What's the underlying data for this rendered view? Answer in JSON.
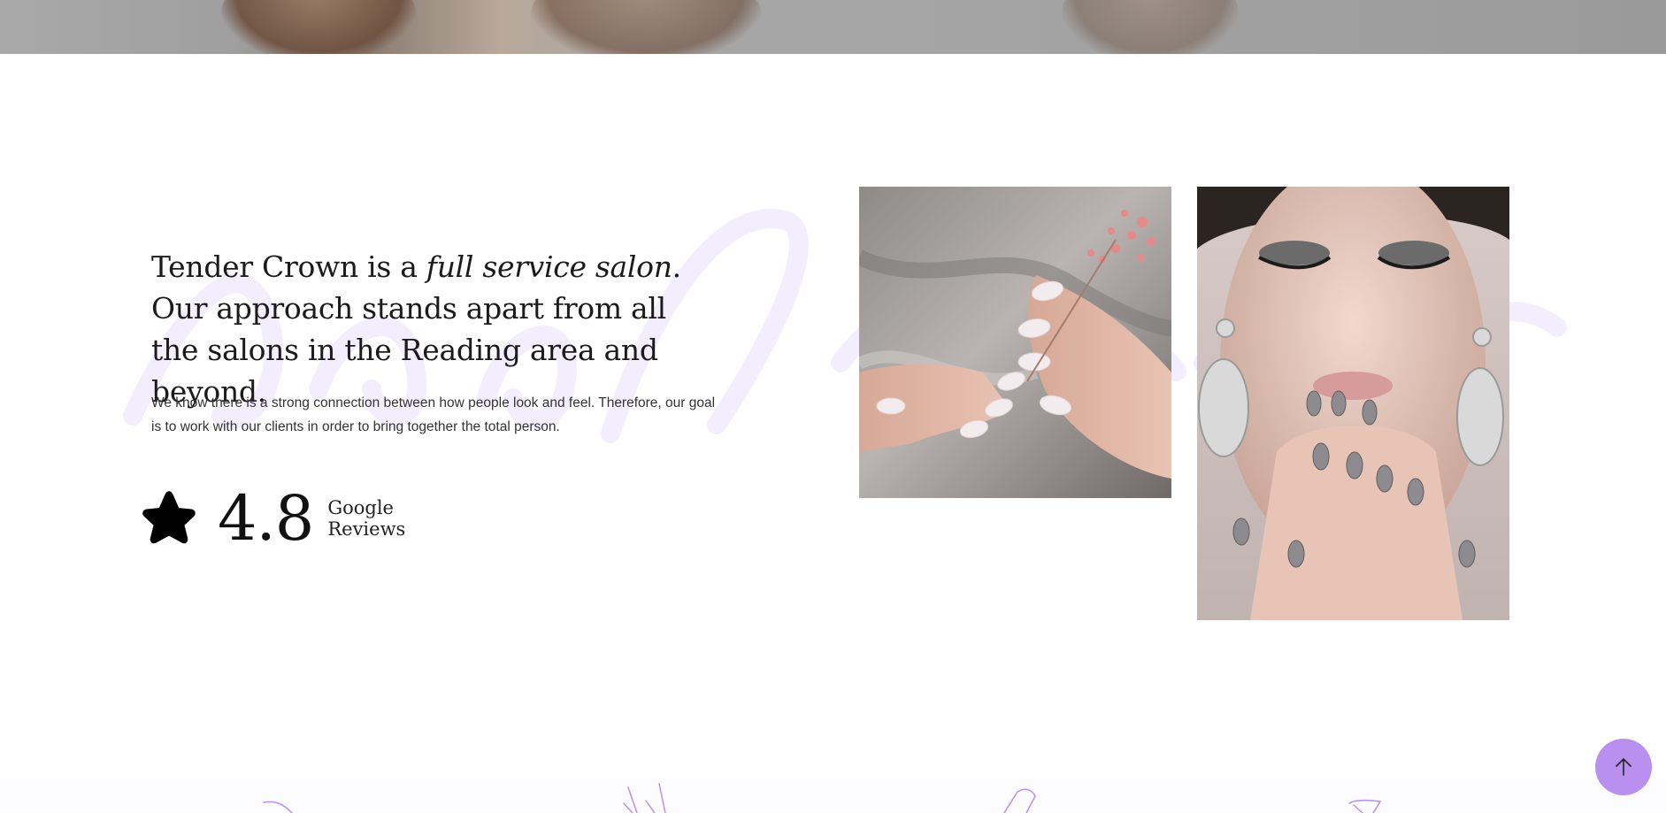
{
  "intro": {
    "heading_part1": "Tender Crown is a ",
    "heading_em": "full service salon",
    "heading_part2": ". Our approach stands apart from all the salons in the Reading area and beyond.",
    "body": "We know there is a strong connection between how people look and feel. Therefore, our goal is to work with our clients in order to bring together the total person."
  },
  "rating": {
    "icon": "star-icon",
    "value": "4.8",
    "label_line1": "Google",
    "label_line2": "Reviews"
  },
  "scroll_top": {
    "icon": "arrow-up-icon"
  },
  "colors": {
    "accent": "#b98ff0",
    "watermark": "#f4efff",
    "text_dark": "#1b1b1b"
  }
}
